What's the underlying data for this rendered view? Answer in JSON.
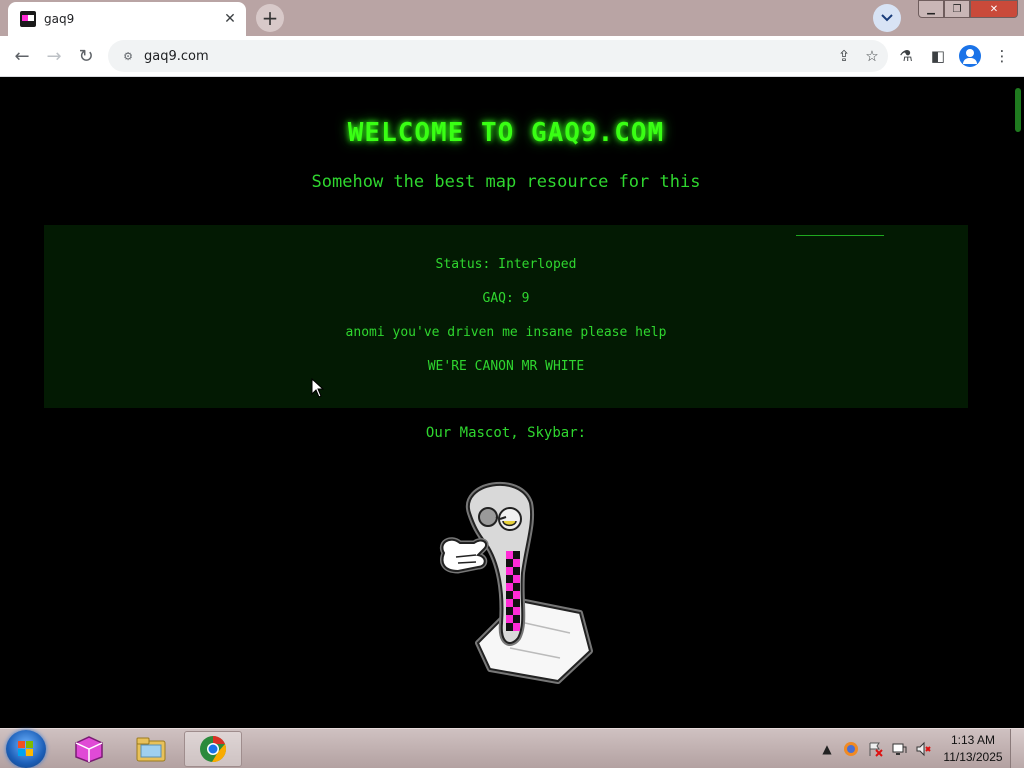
{
  "browser": {
    "tab": {
      "title": "gaq9",
      "favicon": "gaq9-favicon",
      "close_icon": "close-icon"
    },
    "new_tab_icon": "plus-icon",
    "tab_search_icon": "chevron-down-icon",
    "window_controls": [
      "minimize-icon",
      "restore-icon",
      "close-icon"
    ],
    "url": "gaq9.com",
    "toolbar_icons": [
      "back-icon",
      "forward-icon",
      "reload-icon",
      "site-info-icon",
      "share-icon",
      "star-icon",
      "labs-icon",
      "sidepanel-icon",
      "profile-icon",
      "menu-icon"
    ]
  },
  "page": {
    "title": "WELCOME TO GAQ9.COM",
    "subtitle": "Somehow the best map resource for this",
    "info": {
      "status": "Status: Interloped",
      "gaq": "GAQ: 9",
      "plea": "anomi you've driven me insane please help",
      "canon": "WE'RE CANON MR WHITE"
    },
    "mascot_label": "Our Mascot, Skybar:",
    "colors": {
      "background": "#000000",
      "text_green": "#2fd62f",
      "title_glow": "#39ff14",
      "info_box": "#031a03",
      "mascot_checker": "#ff2bd6"
    }
  },
  "taskbar": {
    "apps": [
      "start-orb",
      "gallery-app-icon",
      "file-explorer-icon",
      "chrome-icon"
    ],
    "tray_icons": [
      "tray-expand-icon",
      "firefox-icon",
      "flag-alert-icon",
      "network-icon",
      "volume-muted-icon"
    ],
    "time": "1:13 AM",
    "date": "11/13/2025"
  }
}
